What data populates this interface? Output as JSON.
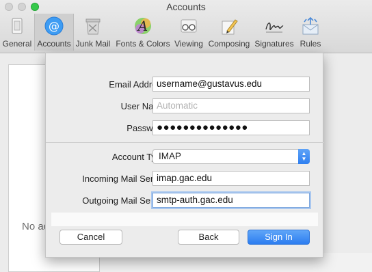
{
  "window": {
    "title": "Accounts"
  },
  "toolbar": {
    "items": [
      {
        "label": "General",
        "icon": "general-icon"
      },
      {
        "label": "Accounts",
        "icon": "at-sign-icon",
        "active": true
      },
      {
        "label": "Junk Mail",
        "icon": "junk-mail-icon"
      },
      {
        "label": "Fonts & Colors",
        "icon": "fonts-colors-icon"
      },
      {
        "label": "Viewing",
        "icon": "glasses-icon"
      },
      {
        "label": "Composing",
        "icon": "pencil-icon"
      },
      {
        "label": "Signatures",
        "icon": "signature-icon"
      },
      {
        "label": "Rules",
        "icon": "rules-icon"
      }
    ]
  },
  "background": {
    "no_accounts_text": "No ac"
  },
  "form": {
    "email_label": "Email Address:",
    "email_value": "username@gustavus.edu",
    "username_label": "User Name:",
    "username_placeholder": "Automatic",
    "password_label": "Password:",
    "password_value": "●●●●●●●●●●●●●●",
    "account_type_label": "Account Type:",
    "account_type_value": "IMAP",
    "incoming_label": "Incoming Mail Server:",
    "incoming_value": "imap.gac.edu",
    "outgoing_label": "Outgoing Mail Server:",
    "outgoing_value": "smtp-auth.gac.edu"
  },
  "buttons": {
    "cancel": "Cancel",
    "back": "Back",
    "sign_in": "Sign In"
  },
  "colors": {
    "accent": "#2c7df0",
    "focus_ring": "#a9c7ef",
    "zoom_button": "#35c94a"
  }
}
